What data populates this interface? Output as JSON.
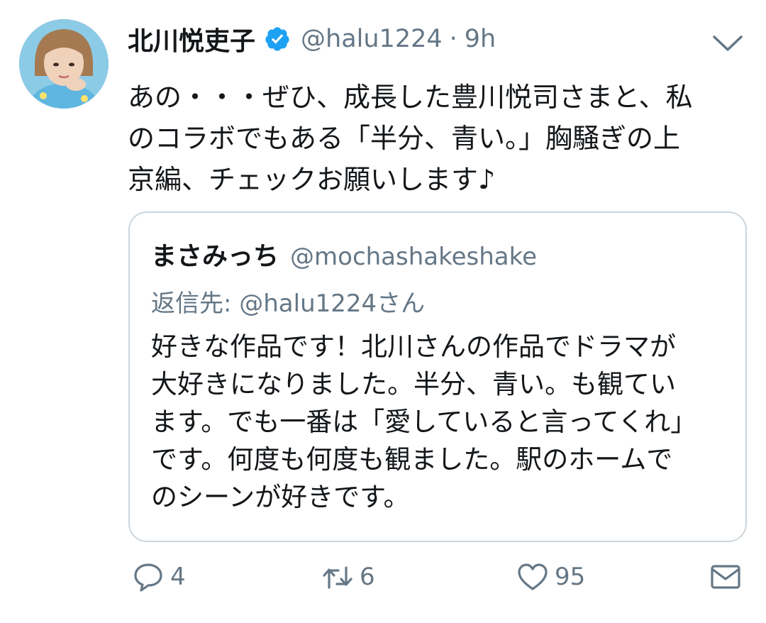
{
  "tweet": {
    "author_name": "北川悦吏子",
    "author_handle": "@halu1224",
    "separator": "·",
    "time": "9h",
    "text": "あの・・・ぜひ、成長した豊川悦司さまと、私\nのコラボでもある「半分、青い。」胸騒ぎの上\n京編、チェックお願いします♪",
    "avatar_icon": "avatar-photo",
    "verified_icon": "verified-badge-icon",
    "menu_icon": "chevron-down-icon"
  },
  "quoted": {
    "author_name": "まさみっち",
    "author_handle": "@mochashakeshake",
    "reply_to": "返信先: @halu1224さん",
    "text": "好きな作品です！北川さんの作品でドラマが\n大好きになりました。半分、青い。も観てい\nます。でも一番は「愛していると言ってくれ」\nです。何度も何度も観ました。駅のホームで\nのシーンが好きです。"
  },
  "actions": {
    "reply_count": "4",
    "retweet_count": "6",
    "like_count": "95",
    "icons": [
      "reply-icon",
      "retweet-icon",
      "like-icon",
      "direct-message-icon"
    ]
  },
  "colors": {
    "verified_blue": "#1da1f2",
    "secondary_text": "#657786",
    "primary_text": "#14171a",
    "border": "#ccd6dd"
  }
}
